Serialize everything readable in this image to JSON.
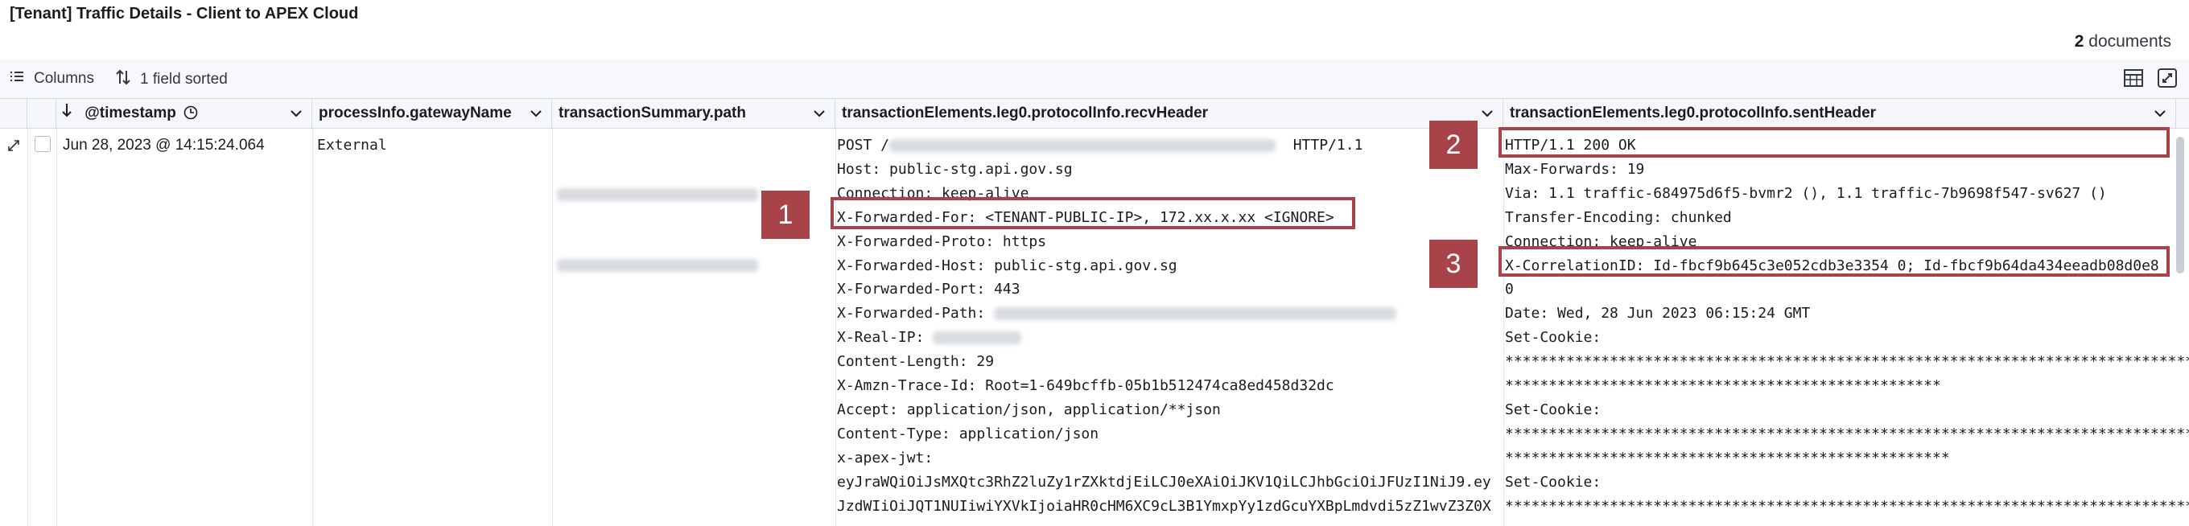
{
  "title": "[Tenant] Traffic Details - Client to APEX Cloud",
  "documents": {
    "count": "2",
    "label": "documents"
  },
  "toolbar": {
    "columns_label": "Columns",
    "sorted_label": "1 field sorted",
    "icons": [
      "columns-icon",
      "sort-icon",
      "density-icon",
      "fullscreen-icon"
    ]
  },
  "columns": {
    "timestamp": "@timestamp",
    "gateway": "processInfo.gatewayName",
    "path": "transactionSummary.path",
    "recv": "transactionElements.leg0.protocolInfo.recvHeader",
    "sent": "transactionElements.leg0.protocolInfo.sentHeader"
  },
  "row": {
    "timestamp": "Jun 28, 2023 @ 14:15:24.064",
    "gateway": "External",
    "recv_lines": [
      "POST /",
      "Host: public-stg.api.gov.sg",
      "Connection: keep-alive",
      "X-Forwarded-For: <TENANT-PUBLIC-IP>, 172.xx.x.xx <IGNORE>",
      "X-Forwarded-Proto: https",
      "X-Forwarded-Host: public-stg.api.gov.sg",
      "X-Forwarded-Port: 443",
      "X-Forwarded-Path: ",
      "X-Real-IP: ",
      "Content-Length: 29",
      "X-Amzn-Trace-Id: Root=1-649bcffb-05b1b512474ca8ed458d32dc",
      "Accept: application/json, application/**json",
      "Content-Type: application/json",
      "x-apex-jwt:",
      "eyJraWQiOiJsMXQtc3RhZ2luZy1rZXktdjEiLCJ0eXAiOiJKV1QiLCJhbGciOiJFUzI1NiJ9.ey",
      "JzdWIiOiJQT1NUIiwiYXVkIjoiaHR0cHM6XC9cL3B1YmxpYy1zdGcuYXBpLmdvdi5zZ1wvZ3Z0X"
    ],
    "recv_http": "HTTP/1.1",
    "sent_lines": [
      "HTTP/1.1 200 OK",
      "Max-Forwards: 19",
      "Via: 1.1 traffic-684975d6f5-bvmr2 (), 1.1 traffic-7b9698f547-sv627 ()",
      "Transfer-Encoding: chunked",
      "Connection: keep-alive",
      "X-CorrelationID: Id-fbcf9b645c3e052cdb3e3354 0; Id-fbcf9b64da434eeadb08d0e8",
      "0",
      "Date: Wed, 28 Jun 2023 06:15:24 GMT",
      "Set-Cookie:",
      "*********************************************************************************",
      "**************************************************",
      "Set-Cookie:",
      "*********************************************************************************",
      "***************************************************",
      "Set-Cookie:",
      "*********************************************************************************"
    ]
  },
  "callouts": {
    "one": "1",
    "two": "2",
    "three": "3"
  },
  "colors": {
    "accent": "#a8434a",
    "header_bg": "#f5f7fa",
    "border": "#d3dae6"
  }
}
